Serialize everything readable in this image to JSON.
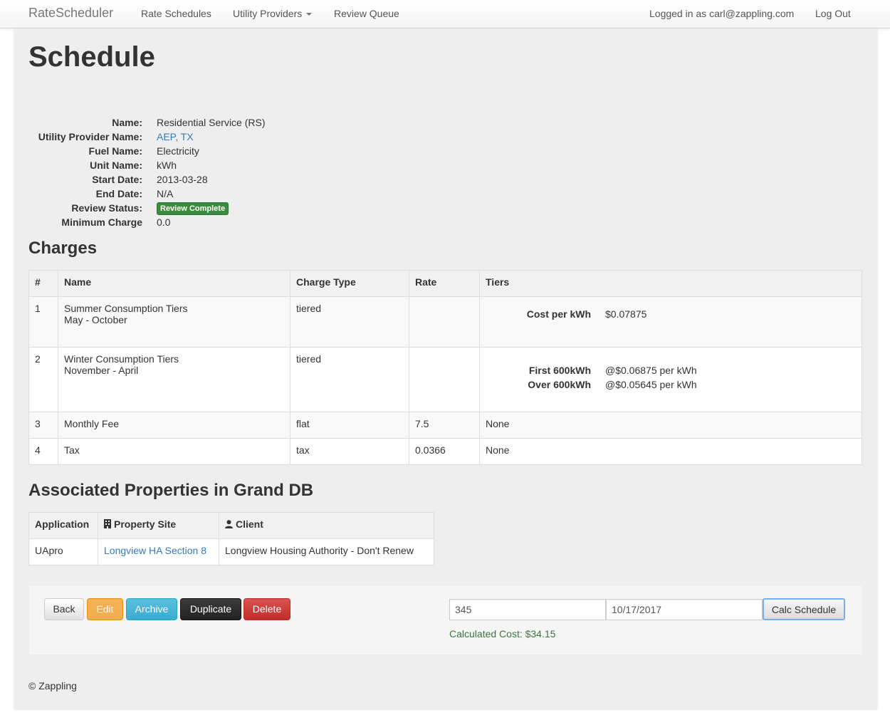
{
  "nav": {
    "brand": "RateScheduler",
    "links": [
      "Rate Schedules",
      "Utility Providers",
      "Review Queue"
    ],
    "user_text": "Logged in as carl@zappling.com",
    "logout": "Log Out"
  },
  "page_title": "Schedule",
  "details": {
    "name_label": "Name:",
    "name": "Residential Service (RS)",
    "provider_label": "Utility Provider Name:",
    "provider": "AEP, TX",
    "fuel_label": "Fuel Name:",
    "fuel": "Electricity",
    "unit_label": "Unit Name:",
    "unit": "kWh",
    "start_label": "Start Date:",
    "start": "2013-03-28",
    "end_label": "End Date:",
    "end": "N/A",
    "review_label": "Review Status:",
    "review": "Review Complete",
    "min_label": "Minimum Charge",
    "min": "0.0"
  },
  "charges": {
    "title": "Charges",
    "headers": [
      "#",
      "Name",
      "Charge Type",
      "Rate",
      "Tiers"
    ],
    "rows": [
      {
        "num": "1",
        "name": "Summer Consumption Tiers",
        "period": "May - October",
        "type": "tiered",
        "rate": "",
        "tiers": [
          {
            "label": "Cost per kWh",
            "value": "$0.07875"
          }
        ]
      },
      {
        "num": "2",
        "name": "Winter Consumption Tiers",
        "period": "November - April",
        "type": "tiered",
        "rate": "",
        "tiers": [
          {
            "label": "First 600kWh",
            "value": "@$0.06875 per kWh"
          },
          {
            "label": "Over 600kWh",
            "value": "@$0.05645 per kWh"
          }
        ]
      },
      {
        "num": "3",
        "name": "Monthly Fee",
        "type": "flat",
        "rate": "7.5",
        "tiers_text": "None"
      },
      {
        "num": "4",
        "name": "Tax",
        "type": "tax",
        "rate": "0.0366",
        "tiers_text": "None"
      }
    ]
  },
  "properties": {
    "title": "Associated Properties in Grand DB",
    "headers": [
      "Application",
      "Property Site",
      "Client"
    ],
    "rows": [
      {
        "application": "UApro",
        "site": "Longview HA Section 8",
        "client": "Longview Housing Authority - Don't Renew"
      }
    ]
  },
  "actions": {
    "back": "Back",
    "edit": "Edit",
    "archive": "Archive",
    "duplicate": "Duplicate",
    "delete": "Delete",
    "usage_value": "345",
    "date_value": "10/17/2017",
    "calc": "Calc Schedule",
    "result": "Calculated Cost: $34.15"
  },
  "footer": "© Zappling",
  "colors": {
    "badge": "#3c8a3e",
    "link": "#337ab7",
    "result": "#3c763d"
  }
}
